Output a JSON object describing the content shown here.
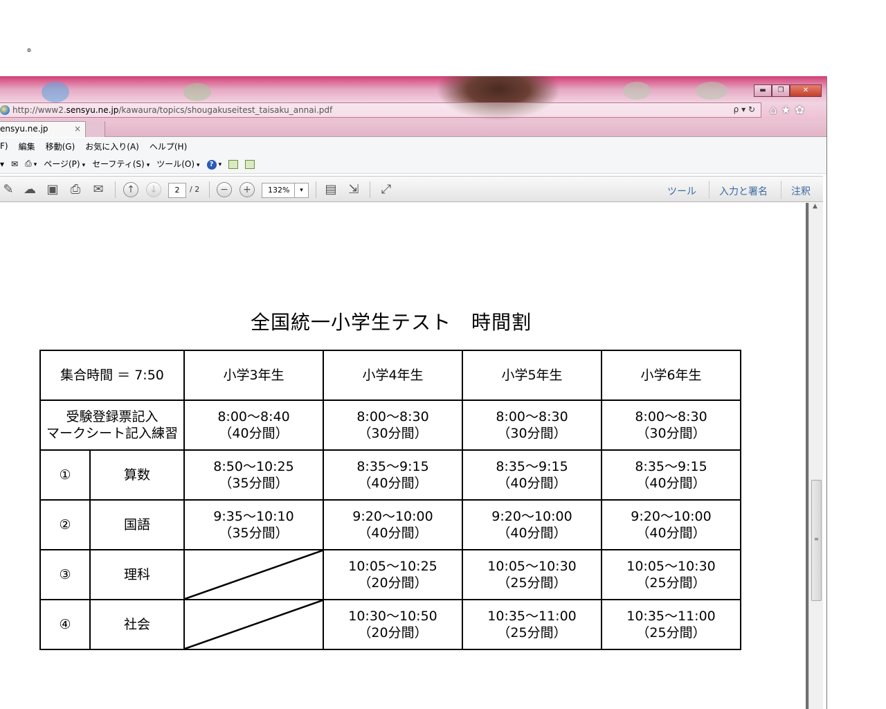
{
  "stray_mark": "๏",
  "browser": {
    "url_prefix": "http://www2.",
    "url_domain": "sensyu.ne.jp",
    "url_path": "/kawaura/topics/shougakuseitest_taisaku_annai.pdf",
    "address_tools": "ρ ▾ ↻",
    "tab_label": "ensyu.ne.jp",
    "tab_close": "×",
    "window_buttons": {
      "minimize": "▬",
      "maximize": "❐",
      "close": "✕"
    },
    "right_icons": {
      "home": "⌂",
      "favorites": "★",
      "tools": "✿"
    },
    "menu": [
      "F)",
      "編集",
      "移動(G)",
      "お気に入り(A)",
      "ヘルプ(H)"
    ],
    "command_bar": {
      "page": "ページ(P)",
      "safety": "セーフティ(S)",
      "tools": "ツール(O)",
      "help_icon": "?"
    }
  },
  "pdf_toolbar": {
    "current_page": "2",
    "total_pages": "/ 2",
    "zoom": "132%",
    "right_tools": [
      "ツール",
      "入力と署名",
      "注釈"
    ]
  },
  "document": {
    "title": "全国統一小学生テスト　時間割",
    "header": {
      "corner": "集合時間 ＝ 7:50",
      "grades": [
        "小学3年生",
        "小学4年生",
        "小学5年生",
        "小学6年生"
      ]
    },
    "registration_row": {
      "label_line1": "受験登録票記入",
      "label_line2": "マークシート記入練習",
      "cells": [
        {
          "time": "8:00〜8:40",
          "duration": "（40分間）"
        },
        {
          "time": "8:00〜8:30",
          "duration": "（30分間）"
        },
        {
          "time": "8:00〜8:30",
          "duration": "（30分間）"
        },
        {
          "time": "8:00〜8:30",
          "duration": "（30分間）"
        }
      ]
    },
    "subjects": [
      {
        "num": "①",
        "name": "算数",
        "cells": [
          {
            "time": "8:50〜10:25",
            "duration": "（35分間）"
          },
          {
            "time": "8:35〜9:15",
            "duration": "（40分間）"
          },
          {
            "time": "8:35〜9:15",
            "duration": "（40分間）"
          },
          {
            "time": "8:35〜9:15",
            "duration": "（40分間）"
          }
        ]
      },
      {
        "num": "②",
        "name": "国語",
        "cells": [
          {
            "time": "9:35〜10:10",
            "duration": "（35分間）"
          },
          {
            "time": "9:20〜10:00",
            "duration": "（40分間）"
          },
          {
            "time": "9:20〜10:00",
            "duration": "（40分間）"
          },
          {
            "time": "9:20〜10:00",
            "duration": "（40分間）"
          }
        ]
      },
      {
        "num": "③",
        "name": "理科",
        "cells": [
          null,
          {
            "time": "10:05〜10:25",
            "duration": "（20分間）"
          },
          {
            "time": "10:05〜10:30",
            "duration": "（25分間）"
          },
          {
            "time": "10:05〜10:30",
            "duration": "（25分間）"
          }
        ]
      },
      {
        "num": "④",
        "name": "社会",
        "cells": [
          null,
          {
            "time": "10:30〜10:50",
            "duration": "（20分間）"
          },
          {
            "time": "10:35〜11:00",
            "duration": "（25分間）"
          },
          {
            "time": "10:35〜11:00",
            "duration": "（25分間）"
          }
        ]
      }
    ]
  },
  "colors": {
    "titlebar_accent": "#d23f76",
    "pdf_link_blue": "#3b6aa0"
  }
}
